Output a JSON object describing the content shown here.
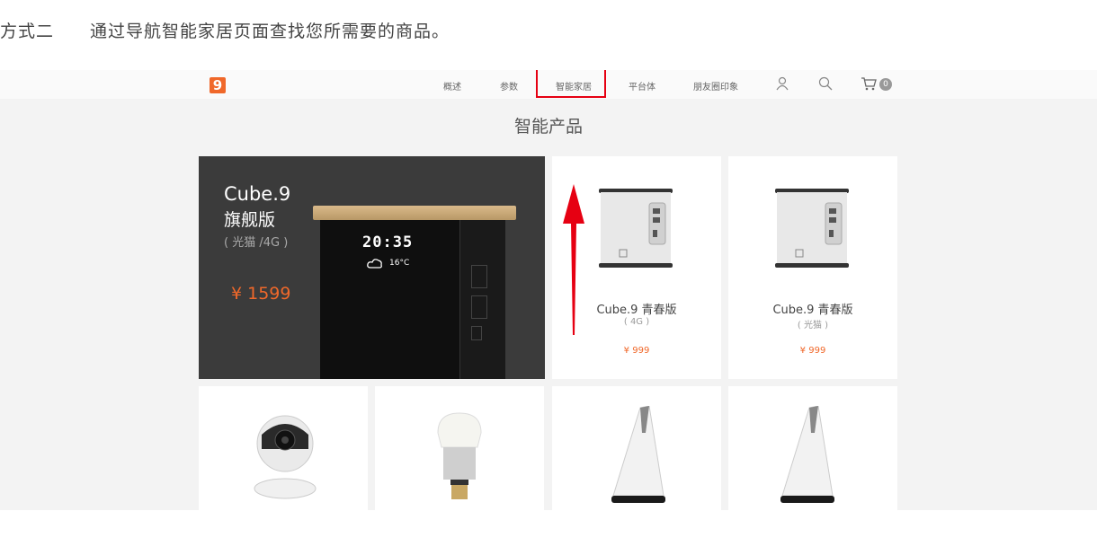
{
  "instruction_text": "方式二　　通过导航智能家居页面查找您所需要的商品。",
  "nav": {
    "logo_text": "9",
    "items": [
      "概述",
      "参数",
      "智能家居",
      "平台体",
      "朋友圈印象"
    ],
    "cart_count": "0"
  },
  "section_title": "智能产品",
  "hero": {
    "name": "Cube.9",
    "edition": "旗舰版",
    "spec": "( 光猫 /4G )",
    "price": "¥ 1599",
    "clock": "20:35",
    "temperature": "16°C"
  },
  "products": [
    {
      "name": "Cube.9 青春版",
      "spec": "( 4G )",
      "price": "¥ 999"
    },
    {
      "name": "Cube.9 青春版",
      "spec": "( 光猫 )",
      "price": "¥ 999"
    }
  ],
  "colors": {
    "accent": "#f0682a",
    "highlight_box": "#e60012",
    "arrow": "#e60012"
  }
}
